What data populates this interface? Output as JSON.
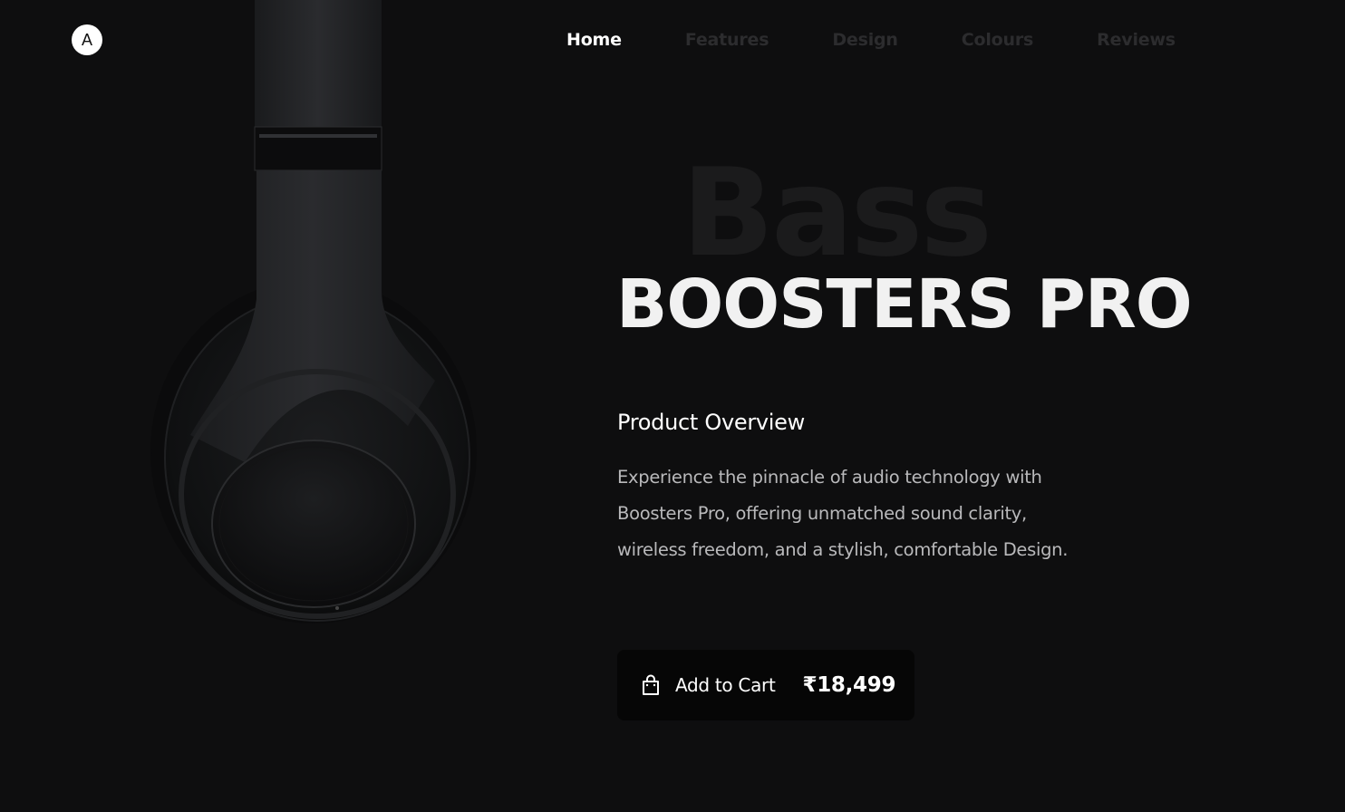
{
  "brand": {
    "logo_letter": "A"
  },
  "nav": {
    "items": [
      {
        "label": "Home",
        "active": true
      },
      {
        "label": "Features",
        "active": false
      },
      {
        "label": "Design",
        "active": false
      },
      {
        "label": "Colours",
        "active": false
      },
      {
        "label": "Reviews",
        "active": false
      }
    ]
  },
  "hero": {
    "background_word": "Bass",
    "title": "BOOSTERS PRO",
    "product_image_icon": "headphones-icon"
  },
  "overview": {
    "heading": "Product Overview",
    "text": "Experience the pinnacle of audio technology with Boosters Pro, offering unmatched sound clarity, wireless freedom, and a stylish, comfortable Design."
  },
  "cart": {
    "icon": "shopping-bag-icon",
    "label": "Add to Cart",
    "price": "₹18,499"
  },
  "colors": {
    "background": "#0e0e0f",
    "accent": "#ffffff",
    "muted_nav": "#2c2c2e"
  }
}
